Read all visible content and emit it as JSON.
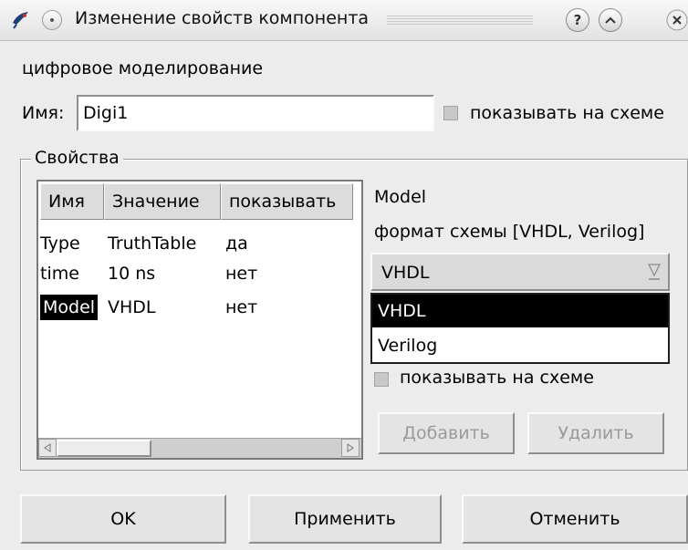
{
  "window": {
    "title": "Изменение свойств компонента",
    "help_label": "?",
    "shade_label": "^",
    "close_label": "x"
  },
  "component_type": "цифровое моделирование",
  "name_row": {
    "label": "Имя:",
    "value": "Digi1",
    "show_on_schematic_label": "показывать на схеме",
    "show_on_schematic": false
  },
  "properties": {
    "group_title": "Свойства",
    "columns": [
      "Имя",
      "Значение",
      "показывать"
    ],
    "rows": [
      {
        "name": "Type",
        "value": "TruthTable",
        "show": "да"
      },
      {
        "name": "time",
        "value": "10 ns",
        "show": "нет"
      },
      {
        "name": "Model",
        "value": "VHDL",
        "show": "нет"
      }
    ],
    "selected_row": 2
  },
  "editor": {
    "property_name": "Model",
    "description": "формат схемы [VHDL, Verilog]",
    "selected_value": "VHDL",
    "options": [
      "VHDL",
      "Verilog"
    ],
    "highlighted_option": "VHDL",
    "show_on_schematic_label": "показывать на схеме",
    "show_on_schematic": false,
    "add_label": "Добавить",
    "remove_label": "Удалить"
  },
  "footer": {
    "ok_label": "OK",
    "apply_label": "Применить",
    "cancel_label": "Отменить"
  }
}
